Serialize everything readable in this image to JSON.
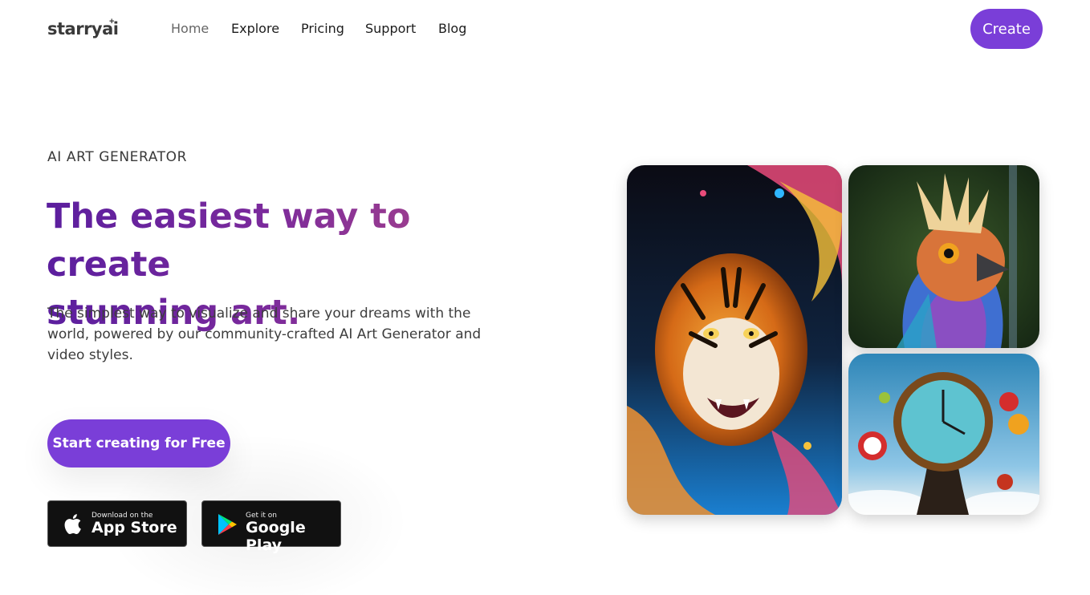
{
  "header": {
    "logo": "starryai",
    "logo_spark": "+",
    "nav": [
      {
        "label": "Home",
        "active": true
      },
      {
        "label": "Explore"
      },
      {
        "label": "Pricing"
      },
      {
        "label": "Support"
      },
      {
        "label": "Blog"
      }
    ],
    "create_label": "Create"
  },
  "hero": {
    "eyebrow": "AI ART GENERATOR",
    "headline_line1": "The easiest way to create",
    "headline_line2": "stunning art.",
    "subtext": "The simplest way to visualize and share your dreams with the world, powered by our community-crafted AI Art Generator and video styles.",
    "cta_label": "Start creating for Free",
    "app_store": {
      "small": "Download on the",
      "big": "App Store"
    },
    "google_play": {
      "small": "Get it on",
      "big": "Google Play"
    }
  },
  "gallery": {
    "images": [
      "tiger-art",
      "bird-art",
      "clock-art"
    ]
  },
  "colors": {
    "accent": "#7a3ed8",
    "headline_gradient": [
      "#5b1e9e",
      "#b14a86"
    ]
  }
}
